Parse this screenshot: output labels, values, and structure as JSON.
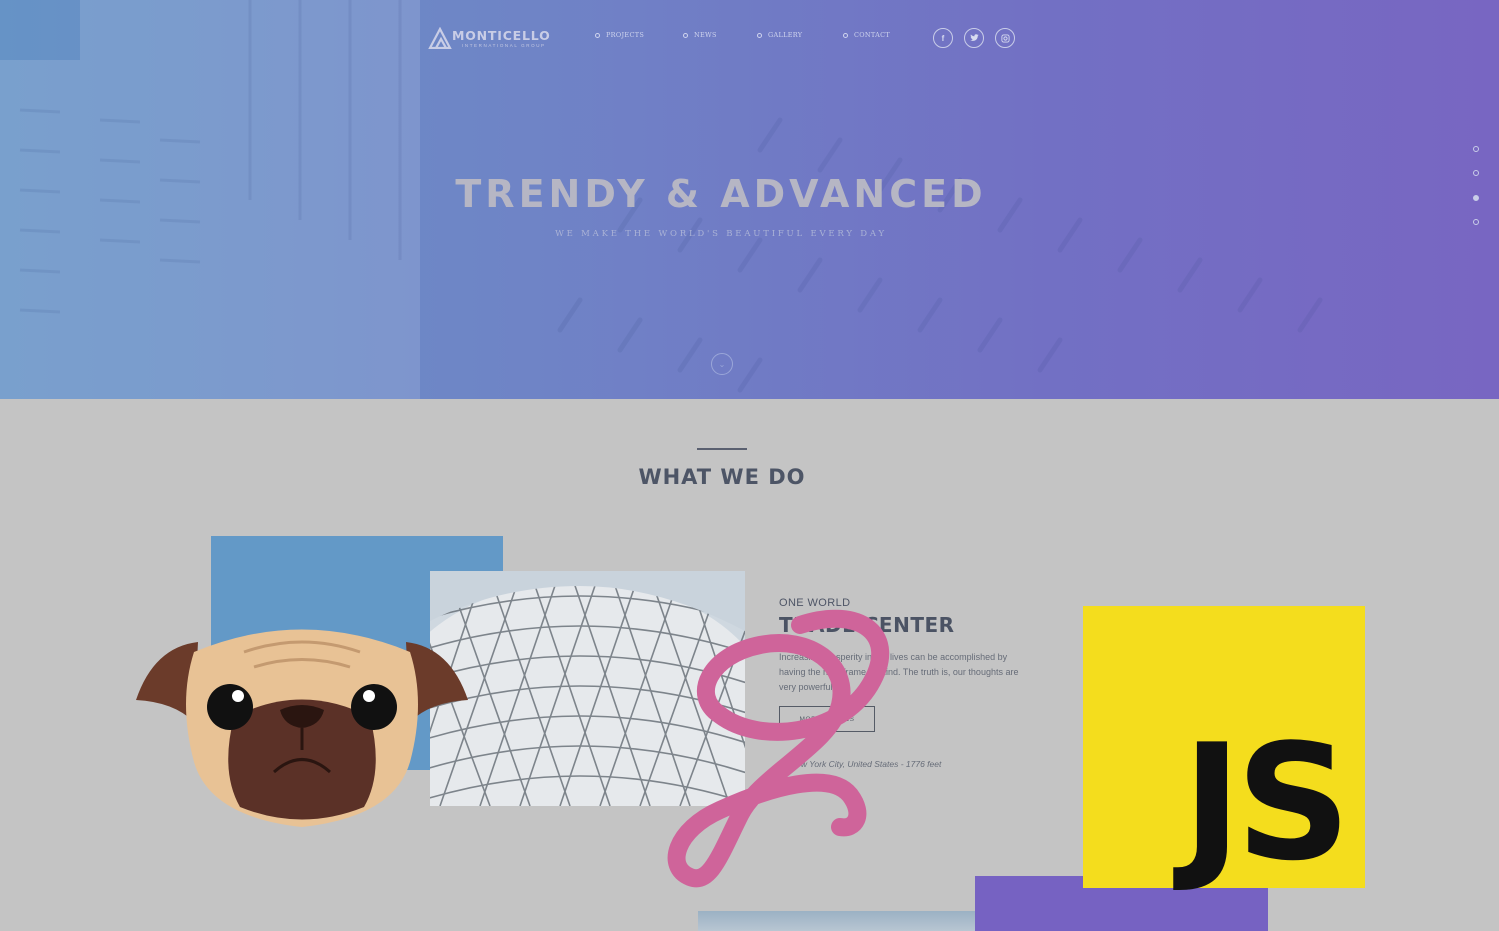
{
  "brand": {
    "name": "MONTICELLO",
    "tagline": "INTERNATIONAL GROUP"
  },
  "nav": {
    "items": [
      {
        "label": "PROJECTS"
      },
      {
        "label": "NEWS"
      },
      {
        "label": "GALLERY"
      },
      {
        "label": "CONTACT"
      }
    ],
    "social": [
      {
        "icon": "facebook-icon",
        "glyph": "f"
      },
      {
        "icon": "twitter-icon",
        "glyph": "t"
      },
      {
        "icon": "instagram-icon",
        "glyph": "◎"
      }
    ]
  },
  "hero": {
    "title": "TRENDY & ADVANCED",
    "subtitle": "WE MAKE THE WORLD'S BEAUTIFUL EVERY DAY",
    "scroll_icon": "chevron-down-icon",
    "scroll_glyph": "⌄",
    "pager": {
      "count": 4,
      "active_index": 2
    }
  },
  "section": {
    "title": "WHAT WE DO",
    "card": {
      "eyebrow": "ONE WORLD",
      "title": "TRADE CENTER",
      "text": "Increasing prosperity in our lives can be accomplished by having the right frame of mind. The truth is, our thoughts are very powerful.",
      "button_label": "MORE DETAILS",
      "location_icon": "map-pin-icon",
      "location": "New York City, United States - 1776 feet"
    }
  },
  "overlays": {
    "js_logo_text": "JS"
  },
  "colors": {
    "hero_gradient_start": "#6693c6",
    "hero_gradient_end": "#7866c2",
    "page_background": "#c4c4c4",
    "blue_block": "#6399c7",
    "purple_block": "#7662c2",
    "js_yellow": "#f4dd1d",
    "sass_pink": "#cf649a",
    "pug_fawn": "#e8c295",
    "pug_muzzle": "#5b3127"
  }
}
